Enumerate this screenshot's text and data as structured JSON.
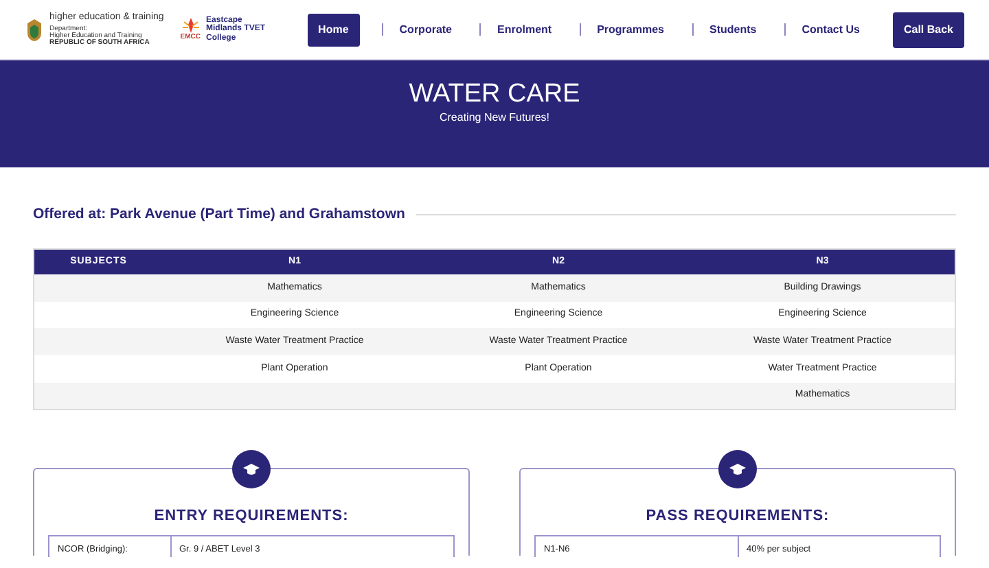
{
  "logo": {
    "dept_title": "higher education & training",
    "dept_sub": "Department:",
    "dept_name": "Higher Education and Training",
    "country": "REPUBLIC OF SOUTH AFRICA",
    "college_badge": "EMCC",
    "college_name": "Eastcape Midlands TVET College"
  },
  "nav": [
    {
      "label": "Home",
      "selected": true
    },
    {
      "label": "Corporate",
      "selected": false
    },
    {
      "label": "Enrolment",
      "selected": false
    },
    {
      "label": "Programmes",
      "selected": false
    },
    {
      "label": "Students",
      "selected": false
    },
    {
      "label": "Contact Us",
      "selected": false
    }
  ],
  "cta": "Call Back",
  "banner": {
    "title": "WATER CARE",
    "subtitle": "Creating New Futures!"
  },
  "offered": "Offered at: Park Avenue (Part Time) and Grahamstown",
  "table": {
    "first_heading": "SUBJECTS",
    "columns": [
      {
        "heading": "N1",
        "subjects": [
          "Mathematics",
          "Engineering Science",
          "Waste Water Treatment Practice",
          "Plant Operation"
        ]
      },
      {
        "heading": "N2",
        "subjects": [
          "Mathematics",
          "Engineering Science",
          "Waste Water Treatment Practice",
          "Plant Operation"
        ]
      },
      {
        "heading": "N3",
        "subjects": [
          "Building Drawings",
          "Engineering Science",
          "Waste Water Treatment Practice",
          "Water Treatment Practice",
          "Mathematics"
        ]
      }
    ]
  },
  "requirements": [
    {
      "title": "ENTRY REQUIREMENTS:",
      "rows": [
        {
          "label": "NCOR (Bridging):",
          "value": "Gr. 9 / ABET Level 3"
        }
      ]
    },
    {
      "title": "PASS REQUIREMENTS:",
      "rows": [
        {
          "label": "N1-N6",
          "value": "40% per subject"
        }
      ]
    }
  ]
}
